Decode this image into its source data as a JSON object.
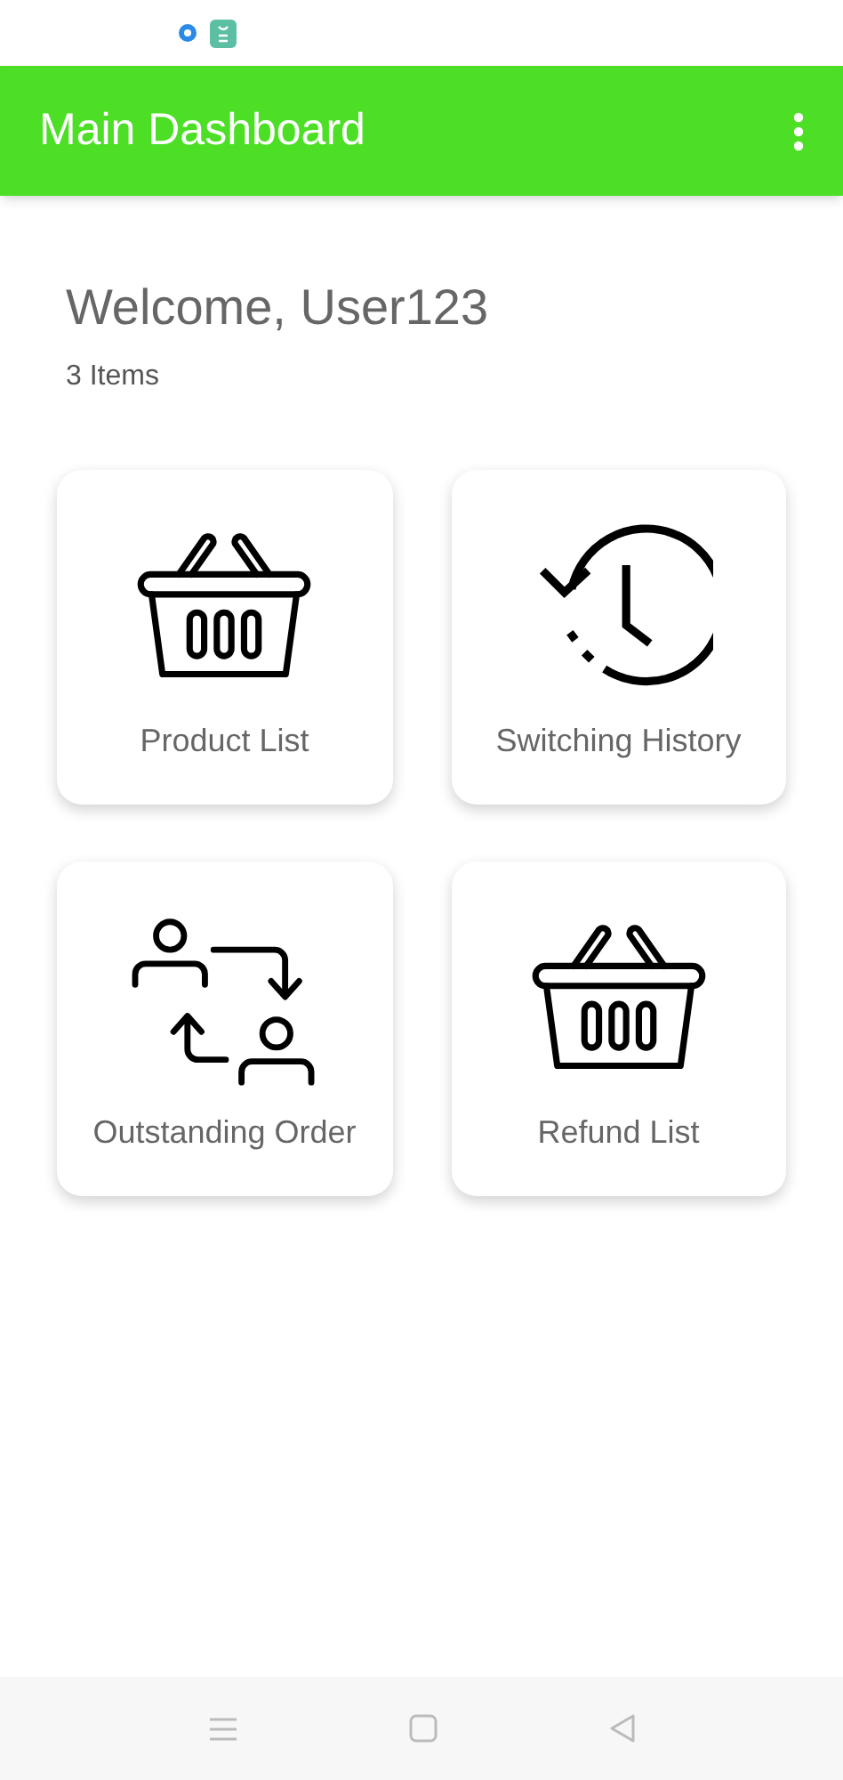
{
  "app_bar": {
    "title": "Main Dashboard"
  },
  "welcome": {
    "greeting": "Welcome, User123",
    "count": "3 Items"
  },
  "tiles": [
    {
      "label": "Product List",
      "kind": "basket"
    },
    {
      "label": "Switching History",
      "kind": "history"
    },
    {
      "label": "Outstanding Order",
      "kind": "exchange"
    },
    {
      "label": "Refund List",
      "kind": "basket"
    }
  ]
}
